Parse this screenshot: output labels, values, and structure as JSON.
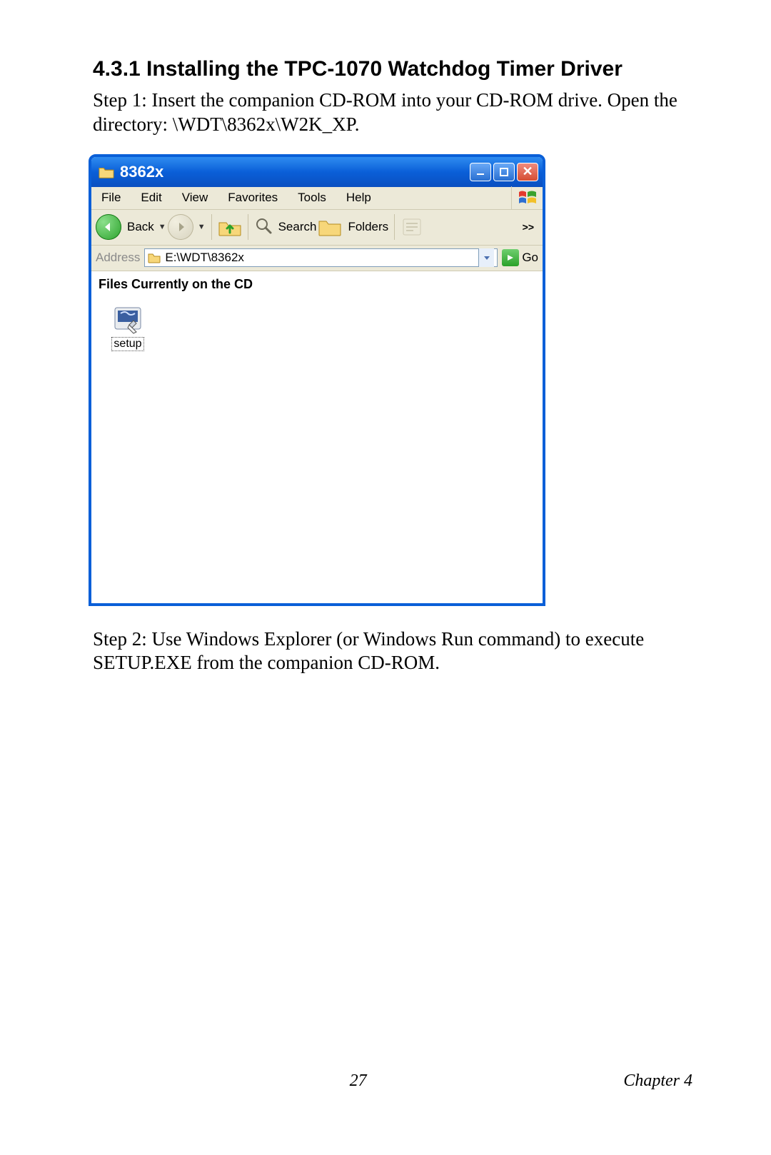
{
  "heading": "4.3.1 Installing the TPC-1070 Watchdog Timer Driver",
  "step1": "Step 1: Insert the companion CD-ROM into your CD-ROM drive. Open the directory: \\WDT\\8362x\\W2K_XP.",
  "step2": "Step 2: Use Windows Explorer (or Windows Run command) to execute SETUP.EXE from the companion CD-ROM.",
  "window": {
    "title": "8362x",
    "menus": {
      "file": "File",
      "edit": "Edit",
      "view": "View",
      "favorites": "Favorites",
      "tools": "Tools",
      "help": "Help"
    },
    "toolbar": {
      "back": "Back",
      "search": "Search",
      "folders": "Folders",
      "chevron": ">>"
    },
    "address": {
      "label": "Address",
      "value": "E:\\WDT\\8362x",
      "go": "Go"
    },
    "section_header": "Files Currently on the CD",
    "file": {
      "name": "setup"
    }
  },
  "footer": {
    "page": "27",
    "chapter": "Chapter 4"
  }
}
